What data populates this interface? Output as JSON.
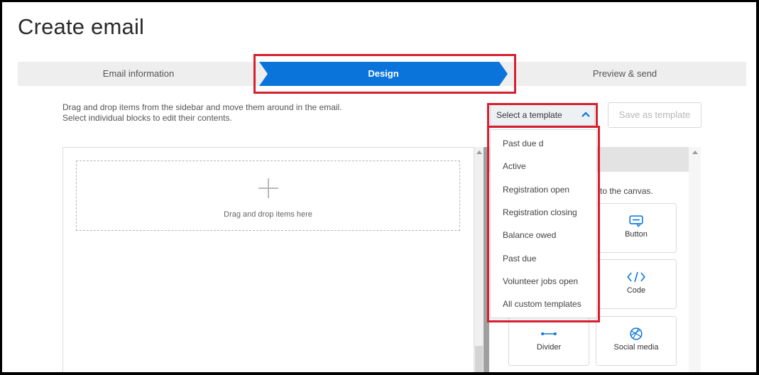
{
  "page": {
    "title": "Create email"
  },
  "stepper": {
    "steps": [
      {
        "label": "Email information"
      },
      {
        "label": "Design"
      },
      {
        "label": "Preview & send"
      }
    ],
    "active_color": "#0a74da"
  },
  "instructions": {
    "line1": "Drag and drop items from the sidebar and move them around in the email.",
    "line2": "Select individual blocks to edit their contents."
  },
  "template_select": {
    "value": "Select a template",
    "options": [
      "Past due d",
      "Active",
      "Registration open",
      "Registration closing",
      "Balance owed",
      "Past due",
      "Volunteer jobs open",
      "All custom templates"
    ]
  },
  "save_template_label": "Save as template",
  "canvas": {
    "dropzone_text": "Drag and drop items here"
  },
  "sidebar": {
    "hint_fragment": "to the canvas.",
    "blocks": [
      {
        "label": "Button",
        "icon": "button-icon"
      },
      {
        "label": "Code",
        "icon": "code-icon"
      },
      {
        "label": "Divider",
        "icon": "divider-icon"
      },
      {
        "label": "Social media",
        "icon": "social-media-icon"
      }
    ]
  },
  "colors": {
    "accent": "#0a74da",
    "highlight": "#d81f30"
  }
}
